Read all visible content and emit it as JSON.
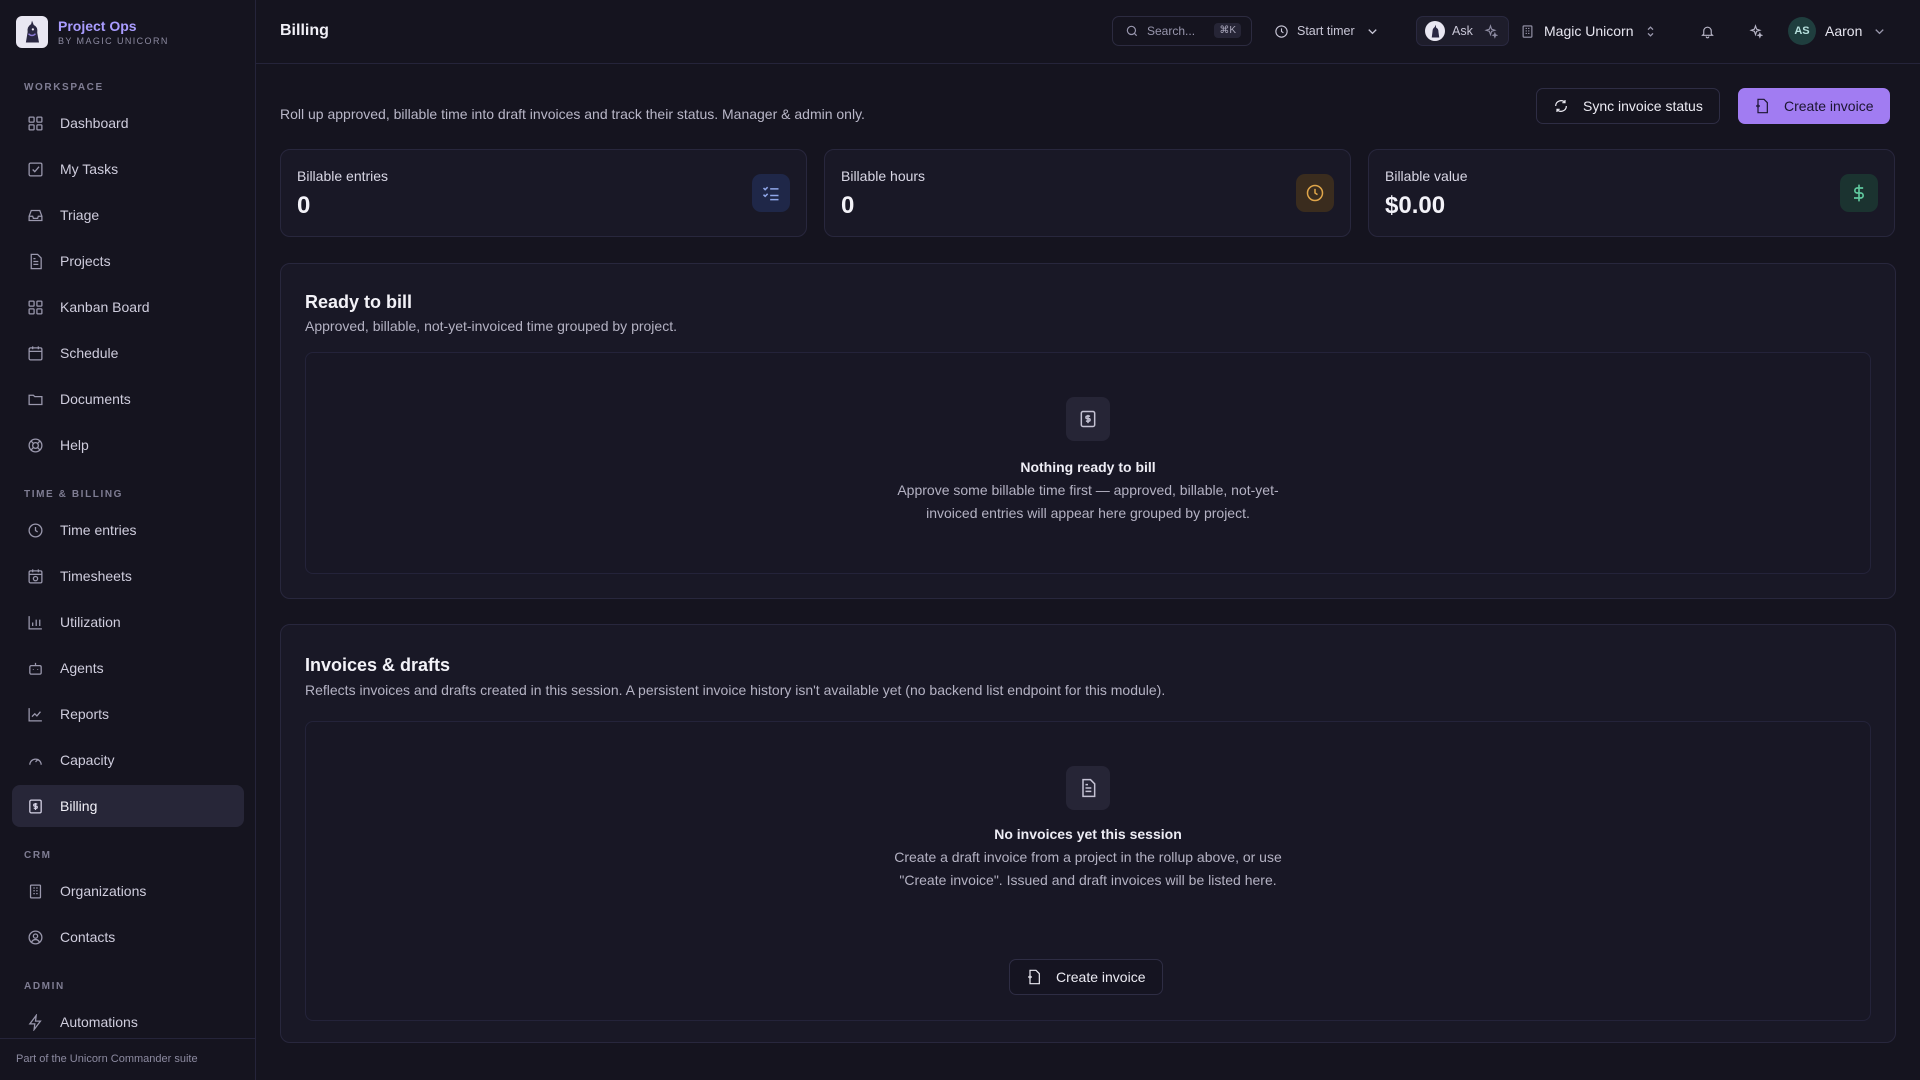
{
  "brand": {
    "name": "Project Ops",
    "subtitle": "BY MAGIC UNICORN"
  },
  "sidebar": {
    "sections": [
      {
        "label": "WORKSPACE"
      },
      {
        "label": "TIME & BILLING"
      },
      {
        "label": "CRM"
      },
      {
        "label": "ADMIN"
      }
    ],
    "items": [
      {
        "label": "Dashboard",
        "icon": "grid-icon"
      },
      {
        "label": "My Tasks",
        "icon": "checkbox-icon"
      },
      {
        "label": "Triage",
        "icon": "inbox-icon"
      },
      {
        "label": "Projects",
        "icon": "document-icon"
      },
      {
        "label": "Kanban Board",
        "icon": "grid-icon"
      },
      {
        "label": "Schedule",
        "icon": "calendar-icon"
      },
      {
        "label": "Documents",
        "icon": "folder-icon"
      },
      {
        "label": "Help",
        "icon": "lifebuoy-icon"
      },
      {
        "label": "Time entries",
        "icon": "clock-icon"
      },
      {
        "label": "Timesheets",
        "icon": "calendar-clock-icon"
      },
      {
        "label": "Utilization",
        "icon": "bar-chart-icon"
      },
      {
        "label": "Agents",
        "icon": "bot-icon"
      },
      {
        "label": "Reports",
        "icon": "line-chart-icon"
      },
      {
        "label": "Capacity",
        "icon": "gauge-icon"
      },
      {
        "label": "Billing",
        "icon": "receipt-icon",
        "active": true
      },
      {
        "label": "Organizations",
        "icon": "building-icon"
      },
      {
        "label": "Contacts",
        "icon": "user-circle-icon"
      },
      {
        "label": "Automations",
        "icon": "zap-icon"
      }
    ],
    "footer": "Part of the Unicorn Commander suite"
  },
  "header": {
    "title": "Billing",
    "search_placeholder": "Search...",
    "search_shortcut": "⌘K",
    "timer_label": "Start timer",
    "ask_label": "Ask",
    "org_label": "Magic Unicorn",
    "user_initials": "AS",
    "user_name": "Aaron"
  },
  "main": {
    "intro": "Roll up approved, billable time into draft invoices and track their status. Manager & admin only.",
    "sync_label": "Sync invoice status",
    "create_label": "Create invoice",
    "stats": [
      {
        "label": "Billable entries",
        "value": "0",
        "icon": "list-check-icon",
        "color": "#1f2748",
        "icon_color": "#8fa6e8"
      },
      {
        "label": "Billable hours",
        "value": "0",
        "icon": "clock-icon",
        "color": "#3a2c1e",
        "icon_color": "#e0a64a"
      },
      {
        "label": "Billable value",
        "value": "$0.00",
        "icon": "dollar-icon",
        "color": "#1b3330",
        "icon_color": "#5fc79d"
      }
    ],
    "ready": {
      "title": "Ready to bill",
      "subtitle": "Approved, billable, not-yet-invoiced time grouped by project.",
      "empty_title": "Nothing ready to bill",
      "empty_desc": "Approve some billable time first — approved, billable, not-yet-invoiced entries will appear here grouped by project."
    },
    "invoices": {
      "title": "Invoices & drafts",
      "subtitle": "Reflects invoices and drafts created in this session. A persistent invoice history isn't available yet (no backend list endpoint for this module).",
      "empty_title": "No invoices yet this session",
      "empty_desc": "Create a draft invoice from a project in the rollup above, or use \"Create invoice\". Issued and draft invoices will be listed here.",
      "button_label": "Create invoice"
    }
  },
  "colors": {
    "accent": "#a17cf2",
    "background": "#15141f",
    "card": "#191826"
  }
}
